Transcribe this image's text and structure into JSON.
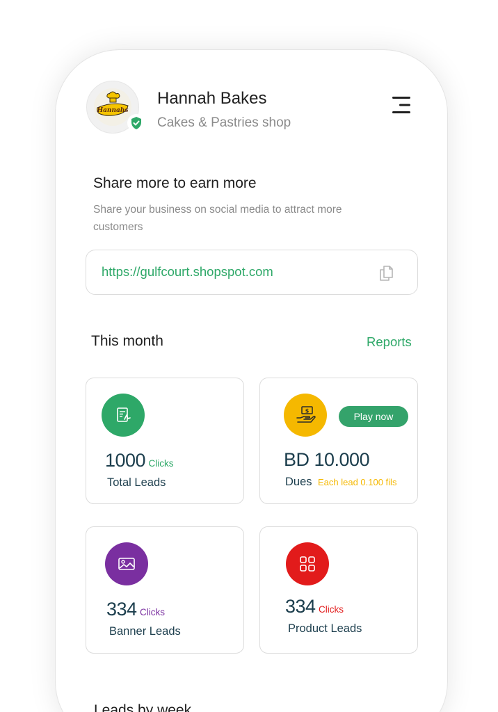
{
  "header": {
    "shop_name": "Hannah Bakes",
    "shop_type": "Cakes & Pastries shop",
    "logo_text": "Hannahs",
    "verified_color": "#2ea868"
  },
  "share": {
    "title": "Share more to earn more",
    "description": "Share your business on social media to attract more customers",
    "url": "https://gulfcourt.shopspot.com"
  },
  "month": {
    "title": "This month",
    "reports_label": "Reports"
  },
  "cards": {
    "total_leads": {
      "value": "1000",
      "unit": "Clicks",
      "label": "Total Leads",
      "icon": "document-icon",
      "color": "#2ea868"
    },
    "dues": {
      "value": "BD 10.000",
      "label": "Dues",
      "note": "Each lead 0.100 fils",
      "button": "Play now",
      "icon": "money-hand-icon",
      "color": "#f5b800"
    },
    "banner_leads": {
      "value": "334",
      "unit": "Clicks",
      "label": "Banner Leads",
      "icon": "image-icon",
      "color": "#7a2fa0"
    },
    "product_leads": {
      "value": "334",
      "unit": "Clicks",
      "label": "Product Leads",
      "icon": "grid-icon",
      "color": "#e21b1b"
    }
  },
  "weekly": {
    "title": "Leads by week"
  }
}
